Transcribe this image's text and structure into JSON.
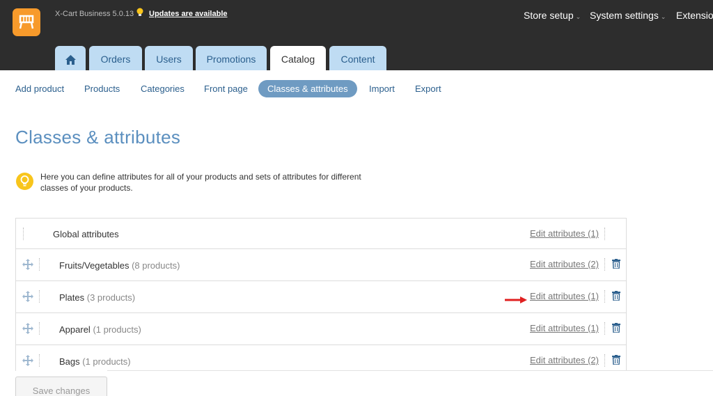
{
  "header": {
    "version": "X-Cart Business 5.0.13",
    "updates_link": "Updates are available",
    "menus": [
      "Store setup",
      "System settings",
      "Extensions"
    ]
  },
  "tabs": [
    {
      "label": "",
      "icon": "home-icon"
    },
    {
      "label": "Orders"
    },
    {
      "label": "Users"
    },
    {
      "label": "Promotions"
    },
    {
      "label": "Catalog"
    },
    {
      "label": "Content"
    }
  ],
  "subnav": [
    "Add product",
    "Products",
    "Categories",
    "Front page",
    "Classes & attributes",
    "Import",
    "Export"
  ],
  "page": {
    "title": "Classes & attributes",
    "info": "Here you can define attributes for all of your products and sets of attributes for different classes of your products."
  },
  "rows": [
    {
      "name": "Global attributes",
      "count": "",
      "edit": "Edit attributes (1)"
    },
    {
      "name": "Fruits/Vegetables",
      "count": "(8 products)",
      "edit": "Edit attributes (2)"
    },
    {
      "name": "Plates",
      "count": "(3 products)",
      "edit": "Edit attributes (1)"
    },
    {
      "name": "Apparel",
      "count": "(1 products)",
      "edit": "Edit attributes (1)"
    },
    {
      "name": "Bags",
      "count": "(1 products)",
      "edit": "Edit attributes (2)"
    }
  ],
  "footer": {
    "save_label": "Save changes"
  },
  "colors": {
    "accent": "#6f9bc2",
    "logo": "#f79a2b",
    "arrow": "#e02020"
  }
}
